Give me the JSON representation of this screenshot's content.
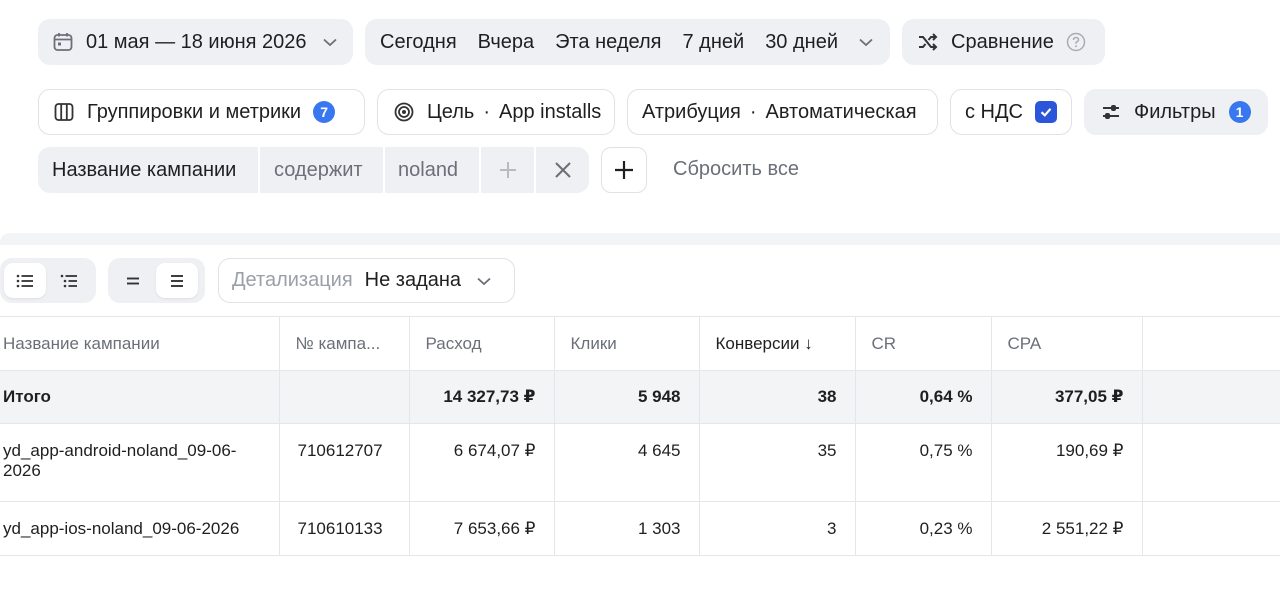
{
  "date_range": {
    "label": "01 мая — 18 июня 2026"
  },
  "periods": [
    "Сегодня",
    "Вчера",
    "Эта неделя",
    "7 дней",
    "30 дней"
  ],
  "compare": {
    "label": "Сравнение"
  },
  "grouping": {
    "label": "Группировки и метрики",
    "count": "7"
  },
  "goal": {
    "label": "Цель",
    "value": "App installs"
  },
  "attribution": {
    "label": "Атрибуция",
    "value": "Автоматическая"
  },
  "vat": {
    "label": "с НДС",
    "checked": true
  },
  "filters": {
    "label": "Фильтры",
    "count": "1"
  },
  "filter_chip": {
    "field": "Название кампании",
    "operator": "содержит",
    "value": "noland"
  },
  "reset_all": "Сбросить все",
  "detail": {
    "label": "Детализация",
    "value": "Не задана"
  },
  "accent_color": "#3877f0",
  "table": {
    "columns": [
      "Название кампании",
      "№ кампа...",
      "Расход",
      "Клики",
      "Конверсии ↓",
      "CR",
      "CPA"
    ],
    "total": {
      "name": "Итого",
      "id": "",
      "spend": "14 327,73 ₽",
      "clicks": "5 948",
      "conversions": "38",
      "cr": "0,64 %",
      "cpa": "377,05 ₽"
    },
    "rows": [
      {
        "name": "yd_app-android-noland_09-06-2026",
        "id": "710612707",
        "spend": "6 674,07 ₽",
        "clicks": "4 645",
        "conversions": "35",
        "cr": "0,75 %",
        "cpa": "190,69 ₽"
      },
      {
        "name": "yd_app-ios-noland_09-06-2026",
        "id": "710610133",
        "spend": "7 653,66 ₽",
        "clicks": "1 303",
        "conversions": "3",
        "cr": "0,23 %",
        "cpa": "2 551,22 ₽"
      }
    ]
  }
}
